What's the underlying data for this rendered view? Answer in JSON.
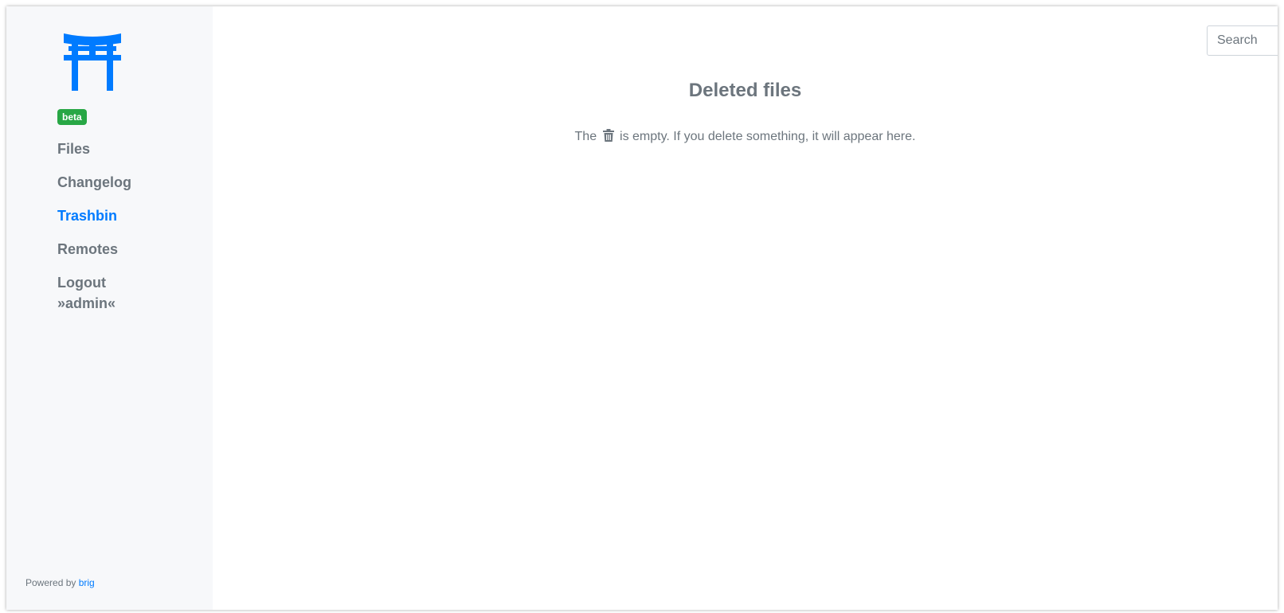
{
  "app": {
    "badge": "beta",
    "logo_icon": "torii-gate-icon",
    "brand_color": "#007bff",
    "badge_color": "#28a745"
  },
  "sidebar": {
    "items": [
      {
        "label": "Files",
        "active": false
      },
      {
        "label": "Changelog",
        "active": false
      },
      {
        "label": "Trashbin",
        "active": true
      },
      {
        "label": "Remotes",
        "active": false
      },
      {
        "label": "Logout",
        "label_line2": "»admin«",
        "active": false
      }
    ],
    "footer": {
      "prefix": "Powered by",
      "link": "brig"
    }
  },
  "search": {
    "placeholder": "Search",
    "value": "",
    "icon": "search-icon"
  },
  "main": {
    "title": "Deleted files",
    "empty_prefix": "The",
    "empty_icon": "trash-icon",
    "empty_suffix": "is empty. If you delete something, it will appear here."
  }
}
